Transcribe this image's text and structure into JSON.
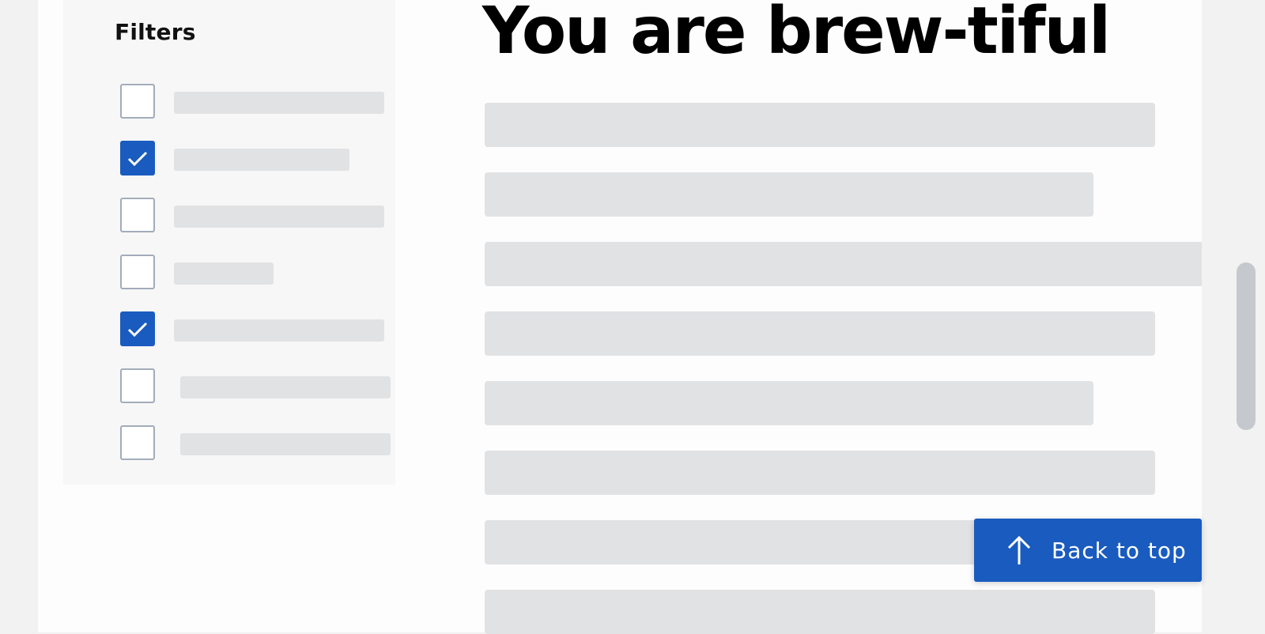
{
  "sidebar": {
    "title": "Filters",
    "items": [
      {
        "checked": false,
        "label": ""
      },
      {
        "checked": true,
        "label": ""
      },
      {
        "checked": false,
        "label": ""
      },
      {
        "checked": false,
        "label": ""
      },
      {
        "checked": true,
        "label": ""
      },
      {
        "checked": false,
        "label": ""
      },
      {
        "checked": false,
        "label": ""
      }
    ]
  },
  "main": {
    "heading": "You are brew-tiful",
    "content_lines": 8
  },
  "back_to_top": {
    "label": "Back to top",
    "icon": "arrow-up-icon"
  },
  "colors": {
    "accent": "#1a5bbf",
    "skeleton": "#e1e2e4",
    "checkbox_border": "#a3acb9"
  }
}
